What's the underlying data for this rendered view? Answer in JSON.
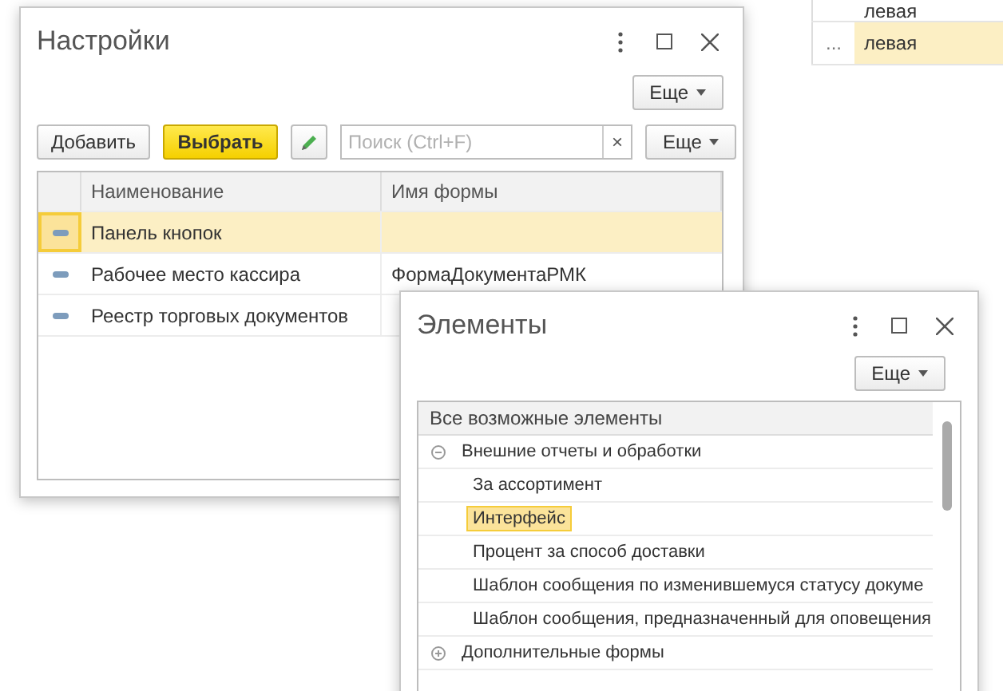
{
  "background_table": {
    "rows": [
      {
        "ellipsis": "",
        "value": "левая",
        "selected": false
      },
      {
        "ellipsis": "...",
        "value": "левая",
        "selected": true
      }
    ]
  },
  "settings_window": {
    "title": "Настройки",
    "more_button": "Еще",
    "toolbar": {
      "add_button": "Добавить",
      "select_button": "Выбрать",
      "search": {
        "placeholder": "Поиск (Ctrl+F)",
        "clear": "×"
      },
      "more_button": "Еще"
    },
    "table": {
      "columns": [
        "Наименование",
        "Имя формы"
      ],
      "rows": [
        {
          "name": "Панель кнопок",
          "form": "",
          "selected": true
        },
        {
          "name": "Рабочее место кассира",
          "form": "ФормаДокументаРМК",
          "selected": false
        },
        {
          "name": "Реестр торговых документов",
          "form": "",
          "selected": false
        }
      ]
    }
  },
  "elements_window": {
    "title": "Элементы",
    "more_button": "Еще",
    "list": {
      "header": "Все возможные элементы",
      "items": [
        {
          "label": "Внешние отчеты и обработки",
          "expanded": true,
          "children": [
            {
              "label": "За ассортимент",
              "selected": false
            },
            {
              "label": "Интерфейс",
              "selected": true
            },
            {
              "label": "Процент за способ доставки",
              "selected": false
            },
            {
              "label": "Шаблон сообщения по изменившемуся статусу докуме",
              "selected": false
            },
            {
              "label": "Шаблон сообщения, предназначенный для оповещения",
              "selected": false
            }
          ]
        },
        {
          "label": "Дополнительные формы",
          "expanded": false
        }
      ]
    }
  }
}
